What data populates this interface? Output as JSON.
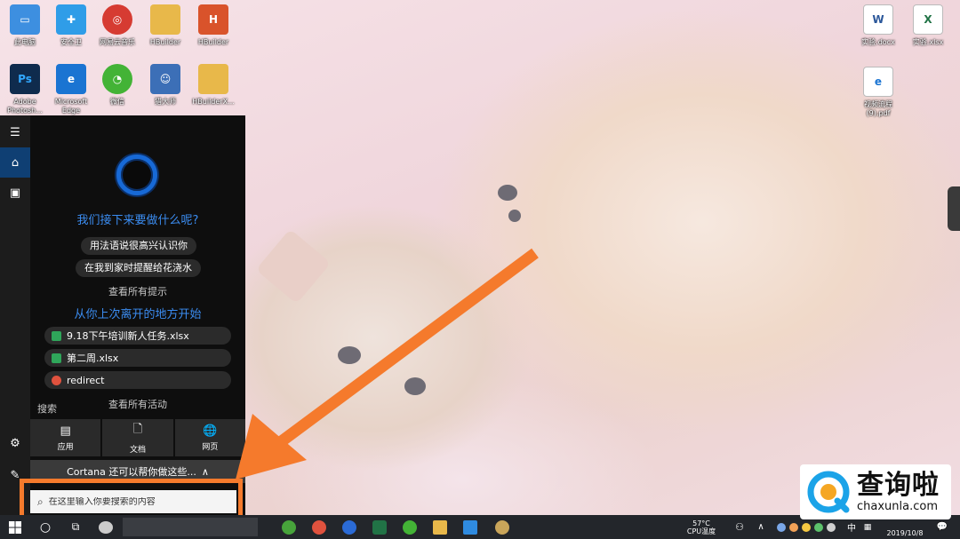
{
  "desktop": {
    "icons": [
      {
        "label": "此电脑",
        "icon": "computer-icon",
        "color": "#3d8fe0"
      },
      {
        "label": "安全卫",
        "icon": "security-icon",
        "color": "#2f9de8"
      },
      {
        "label": "网易云音乐",
        "icon": "music-icon",
        "color": "#d63b32"
      },
      {
        "label": "HBuilder",
        "icon": "folder-icon",
        "color": "#e8b84a"
      },
      {
        "label": "HBuilder",
        "icon": "hbuilder-icon",
        "color": "#d9532b"
      },
      {
        "label": "Adobe Photosh...",
        "icon": "photoshop-icon",
        "color": "#0f2b4d"
      },
      {
        "label": "Microsoft Edge",
        "icon": "edge-icon",
        "color": "#1a74d2"
      },
      {
        "label": "微信",
        "icon": "wechat-icon",
        "color": "#43b336"
      },
      {
        "label": "猎大师",
        "icon": "game-icon",
        "color": "#3c6fb7"
      },
      {
        "label": "HBuilderX...",
        "icon": "folder-icon",
        "color": "#e8b84a"
      },
      {
        "label": "实验.docx",
        "icon": "word-icon",
        "color": "#2b579a"
      },
      {
        "label": "实验.xlsx",
        "icon": "excel-icon",
        "color": "#217346"
      },
      {
        "label": "视频流程 (9).pdf",
        "icon": "pdf-icon",
        "color": "#1a74d2"
      }
    ]
  },
  "cortana": {
    "rail": {
      "menu_icon": "☰",
      "home_icon": "⌂",
      "notebook_icon": "▣",
      "settings_icon": "⚙",
      "feedback_icon": "✎"
    },
    "heading": "我们接下来要做什么呢?",
    "suggestions": [
      "用法语说很高兴认识你",
      "在我到家时提醒给花浇水"
    ],
    "see_all_tips": "查看所有提示",
    "resume_heading": "从你上次离开的地方开始",
    "recent": [
      {
        "name": "9.18下午培训新人任务.xlsx",
        "icon": "excel-icon",
        "color": "#2fa65a"
      },
      {
        "name": "第二周.xlsx",
        "icon": "excel-icon",
        "color": "#2fa65a"
      },
      {
        "name": "redirect",
        "icon": "chrome-icon",
        "color": "#e0523e"
      }
    ],
    "see_all_activity": "查看所有活动",
    "search_label": "搜索",
    "scopes": [
      {
        "label": "应用",
        "glyph": "▤"
      },
      {
        "label": "文档",
        "glyph": "🗋"
      },
      {
        "label": "网页",
        "glyph": "🌐"
      }
    ],
    "more_text": "Cortana 还可以帮你做这些...",
    "more_chevron": "∧"
  },
  "search": {
    "placeholder": "在这里输入你要搜索的内容",
    "icon": "⌕"
  },
  "taskbar": {
    "start_icon": "windows-icon",
    "cortana_icon": "○",
    "taskview_icon": "⧉",
    "apps": [
      {
        "icon": "360-icon",
        "color": "#47a33b"
      },
      {
        "icon": "chrome-icon",
        "color": "#e0523e"
      },
      {
        "icon": "sogou-icon",
        "color": "#2b6bd6"
      },
      {
        "icon": "excel-icon",
        "color": "#217346"
      },
      {
        "icon": "wechat-icon",
        "color": "#43b336"
      },
      {
        "icon": "explorer-icon",
        "color": "#e8b84a"
      },
      {
        "icon": "remote-icon",
        "color": "#2f8be0"
      },
      {
        "icon": "app-icon",
        "color": "#c9a55a"
      }
    ],
    "cpu_temp": "57°C",
    "cpu_label": "CPU温度",
    "ime": "中",
    "date": "2019/10/8",
    "notification_icon": "💬"
  },
  "watermark": {
    "cn": "查询啦",
    "en": "chaxunla.com"
  },
  "colors": {
    "accent_orange": "#f57a2c",
    "cortana_blue": "#3b8cf0",
    "panel_bg": "#0e0e0e"
  }
}
